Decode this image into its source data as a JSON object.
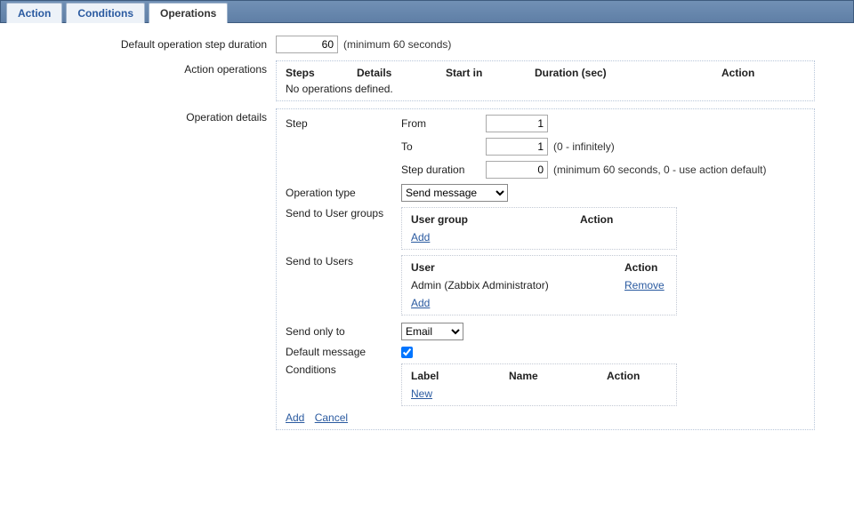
{
  "tabs": {
    "action": "Action",
    "conditions": "Conditions",
    "operations": "Operations"
  },
  "labels": {
    "default_step_duration": "Default operation step duration",
    "min60": "(minimum 60 seconds)",
    "action_operations": "Action operations",
    "operation_details": "Operation details",
    "no_operations": "No operations defined.",
    "steps": "Steps",
    "details": "Details",
    "start_in": "Start in",
    "duration_sec": "Duration (sec)",
    "action": "Action",
    "step": "Step",
    "from": "From",
    "to": "To",
    "infinite": "(0 - infinitely)",
    "step_duration": "Step duration",
    "step_dur_hint": "(minimum 60 seconds, 0 - use action default)",
    "operation_type": "Operation type",
    "send_user_groups": "Send to User groups",
    "send_users": "Send to Users",
    "send_only_to": "Send only to",
    "default_message": "Default message",
    "conditions": "Conditions",
    "user_group": "User group",
    "user": "User",
    "label": "Label",
    "name": "Name",
    "add": "Add",
    "new": "New",
    "remove": "Remove",
    "cancel": "Cancel"
  },
  "values": {
    "default_step_duration": "60",
    "from": "1",
    "to": "1",
    "step_duration": "0",
    "operation_type": "Send message",
    "send_only_to": "Email",
    "default_message_checked": true
  },
  "users": [
    {
      "name": "Admin (Zabbix Administrator)"
    }
  ]
}
